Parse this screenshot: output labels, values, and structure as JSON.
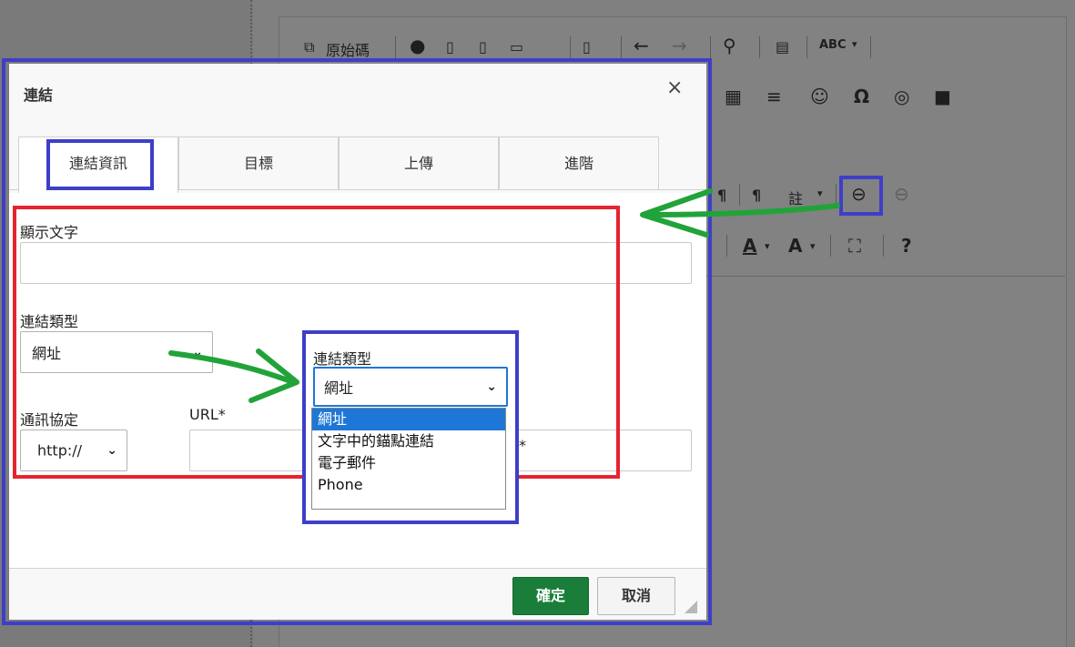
{
  "background_editor": {
    "toolbar_row1": {
      "source_label": "原始碼",
      "icons": [
        "source-icon",
        "accessibility-icon",
        "new-page-icon",
        "preview-icon",
        "print-icon",
        "templates-icon",
        "undo-icon",
        "redo-icon",
        "find-icon",
        "select-all-icon",
        "spellcheck-icon"
      ],
      "spell_label": "ABC"
    },
    "toolbar_row2": {
      "icons": [
        "table-icon",
        "horizontal-rule-icon",
        "smiley-icon",
        "omega-icon",
        "globe-icon",
        "youtube-icon"
      ],
      "omega": "Ω"
    },
    "toolbar_row3": {
      "pilcrow_ltr": "¶",
      "pilcrow_rtl": "¶",
      "language_label": "註",
      "link_icon": "link-icon",
      "unlink_icon": "unlink-icon"
    },
    "toolbar_row4": {
      "text_color_label": "A",
      "bg_color_label": "A",
      "maximize_icon": "maximize-icon",
      "help_label": "?"
    }
  },
  "dialog": {
    "title": "連結",
    "close_symbol": "×",
    "tabs": [
      {
        "label": "連結資訊",
        "active": true
      },
      {
        "label": "目標",
        "active": false
      },
      {
        "label": "上傳",
        "active": false
      },
      {
        "label": "進階",
        "active": false
      }
    ],
    "display_text_label": "顯示文字",
    "display_text_value": "",
    "link_type_label": "連結類型",
    "link_type_value": "網址",
    "protocol_label": "通訊協定",
    "protocol_value": "http://",
    "url_label": "URL*",
    "url_value": "",
    "ok_label": "確定",
    "cancel_label": "取消"
  },
  "zoom_popup": {
    "label": "連結類型",
    "select_value": "網址",
    "options": [
      {
        "label": "網址",
        "selected": true
      },
      {
        "label": "文字中的錨點連結",
        "selected": false
      },
      {
        "label": "電子郵件",
        "selected": false
      },
      {
        "label": "Phone",
        "selected": false
      }
    ],
    "peek_text": "*"
  },
  "colors": {
    "highlight_blue": "#3d3fc8",
    "highlight_red": "#e5242e",
    "arrow_green": "#22a33a",
    "ok_button": "#1a7e3a",
    "selected_option": "#1e77d6"
  }
}
